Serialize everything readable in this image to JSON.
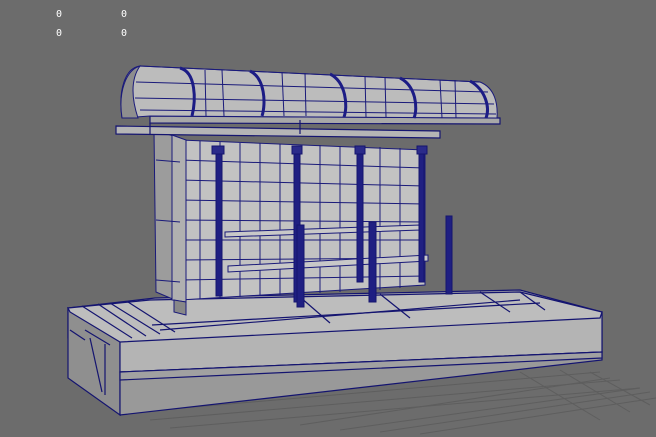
{
  "hud": {
    "row1_col1": "0",
    "row1_col2": "0",
    "row2_col1": "0",
    "row2_col2": "0"
  },
  "colors": {
    "viewport_bg": "#6c6c6c",
    "wire": "#1a1a7a",
    "wire_selected": "#10106a",
    "surface_light": "#bdbdbd",
    "surface_mid": "#a3a3a3",
    "surface_dark": "#8c8c8c",
    "grid_lines": "#5a5a5a"
  },
  "model": {
    "object_name": "bus-shelter",
    "display_mode": "wireframe-on-shaded"
  }
}
